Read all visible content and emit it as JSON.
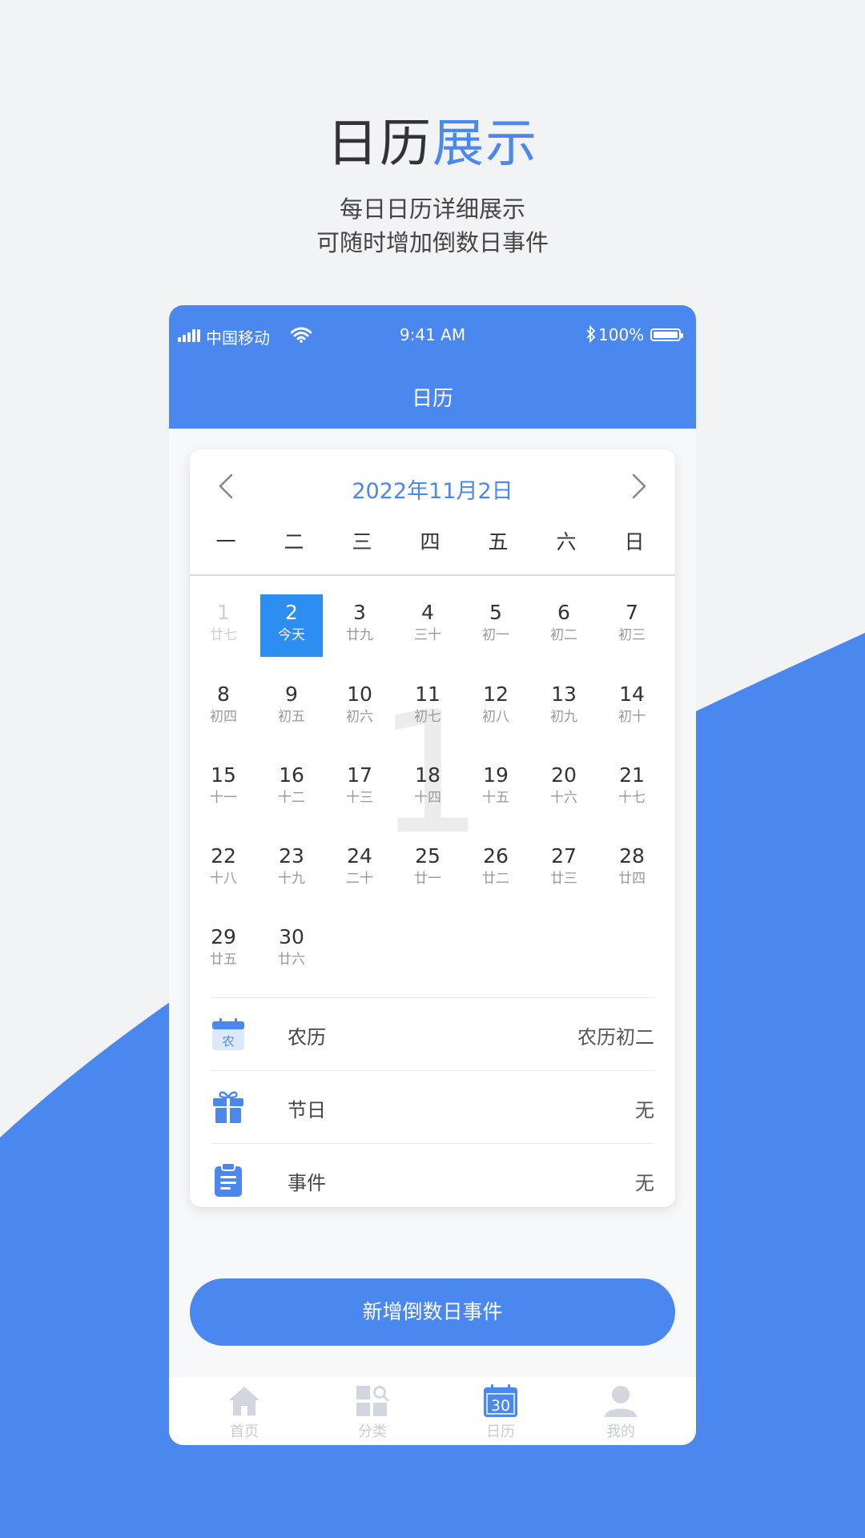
{
  "promo": {
    "title_main": "日历",
    "title_accent": "展示",
    "subtitle_line1": "每日日历详细展示",
    "subtitle_line2": "可随时增加倒数日事件"
  },
  "status_bar": {
    "carrier": "中国移动",
    "time": "9:41 AM",
    "battery": "100%"
  },
  "nav": {
    "title": "日历"
  },
  "calendar": {
    "month_title": "2022年11月2日",
    "weekdays": [
      "一",
      "二",
      "三",
      "四",
      "五",
      "六",
      "日"
    ],
    "watermark": "1",
    "days": [
      {
        "num": "1",
        "lunar": "廿七",
        "faded": true
      },
      {
        "num": "2",
        "lunar": "今天",
        "selected": true
      },
      {
        "num": "3",
        "lunar": "廿九"
      },
      {
        "num": "4",
        "lunar": "三十"
      },
      {
        "num": "5",
        "lunar": "初一"
      },
      {
        "num": "6",
        "lunar": "初二"
      },
      {
        "num": "7",
        "lunar": "初三"
      },
      {
        "num": "8",
        "lunar": "初四"
      },
      {
        "num": "9",
        "lunar": "初五"
      },
      {
        "num": "10",
        "lunar": "初六"
      },
      {
        "num": "11",
        "lunar": "初七"
      },
      {
        "num": "12",
        "lunar": "初八"
      },
      {
        "num": "13",
        "lunar": "初九"
      },
      {
        "num": "14",
        "lunar": "初十"
      },
      {
        "num": "15",
        "lunar": "十一"
      },
      {
        "num": "16",
        "lunar": "十二"
      },
      {
        "num": "17",
        "lunar": "十三"
      },
      {
        "num": "18",
        "lunar": "十四"
      },
      {
        "num": "19",
        "lunar": "十五"
      },
      {
        "num": "20",
        "lunar": "十六"
      },
      {
        "num": "21",
        "lunar": "十七"
      },
      {
        "num": "22",
        "lunar": "十八"
      },
      {
        "num": "23",
        "lunar": "十九"
      },
      {
        "num": "24",
        "lunar": "二十"
      },
      {
        "num": "25",
        "lunar": "廿一"
      },
      {
        "num": "26",
        "lunar": "廿二"
      },
      {
        "num": "27",
        "lunar": "廿三"
      },
      {
        "num": "28",
        "lunar": "廿四"
      },
      {
        "num": "29",
        "lunar": "廿五"
      },
      {
        "num": "30",
        "lunar": "廿六"
      }
    ]
  },
  "info": {
    "lunar": {
      "label": "农历",
      "value": "农历初二",
      "icon": "lunar-calendar-icon",
      "icon_text": "农"
    },
    "festival": {
      "label": "节日",
      "value": "无",
      "icon": "gift-icon"
    },
    "event": {
      "label": "事件",
      "value": "无",
      "icon": "clipboard-icon"
    }
  },
  "add_button": "新增倒数日事件",
  "tabbar": {
    "home": "首页",
    "category": "分类",
    "calendar": "日历",
    "calendar_icon_text": "30",
    "mine": "我的"
  },
  "colors": {
    "accent": "#4a87ee",
    "selected_day": "#2b8ef0",
    "background": "#f2f3f5"
  }
}
